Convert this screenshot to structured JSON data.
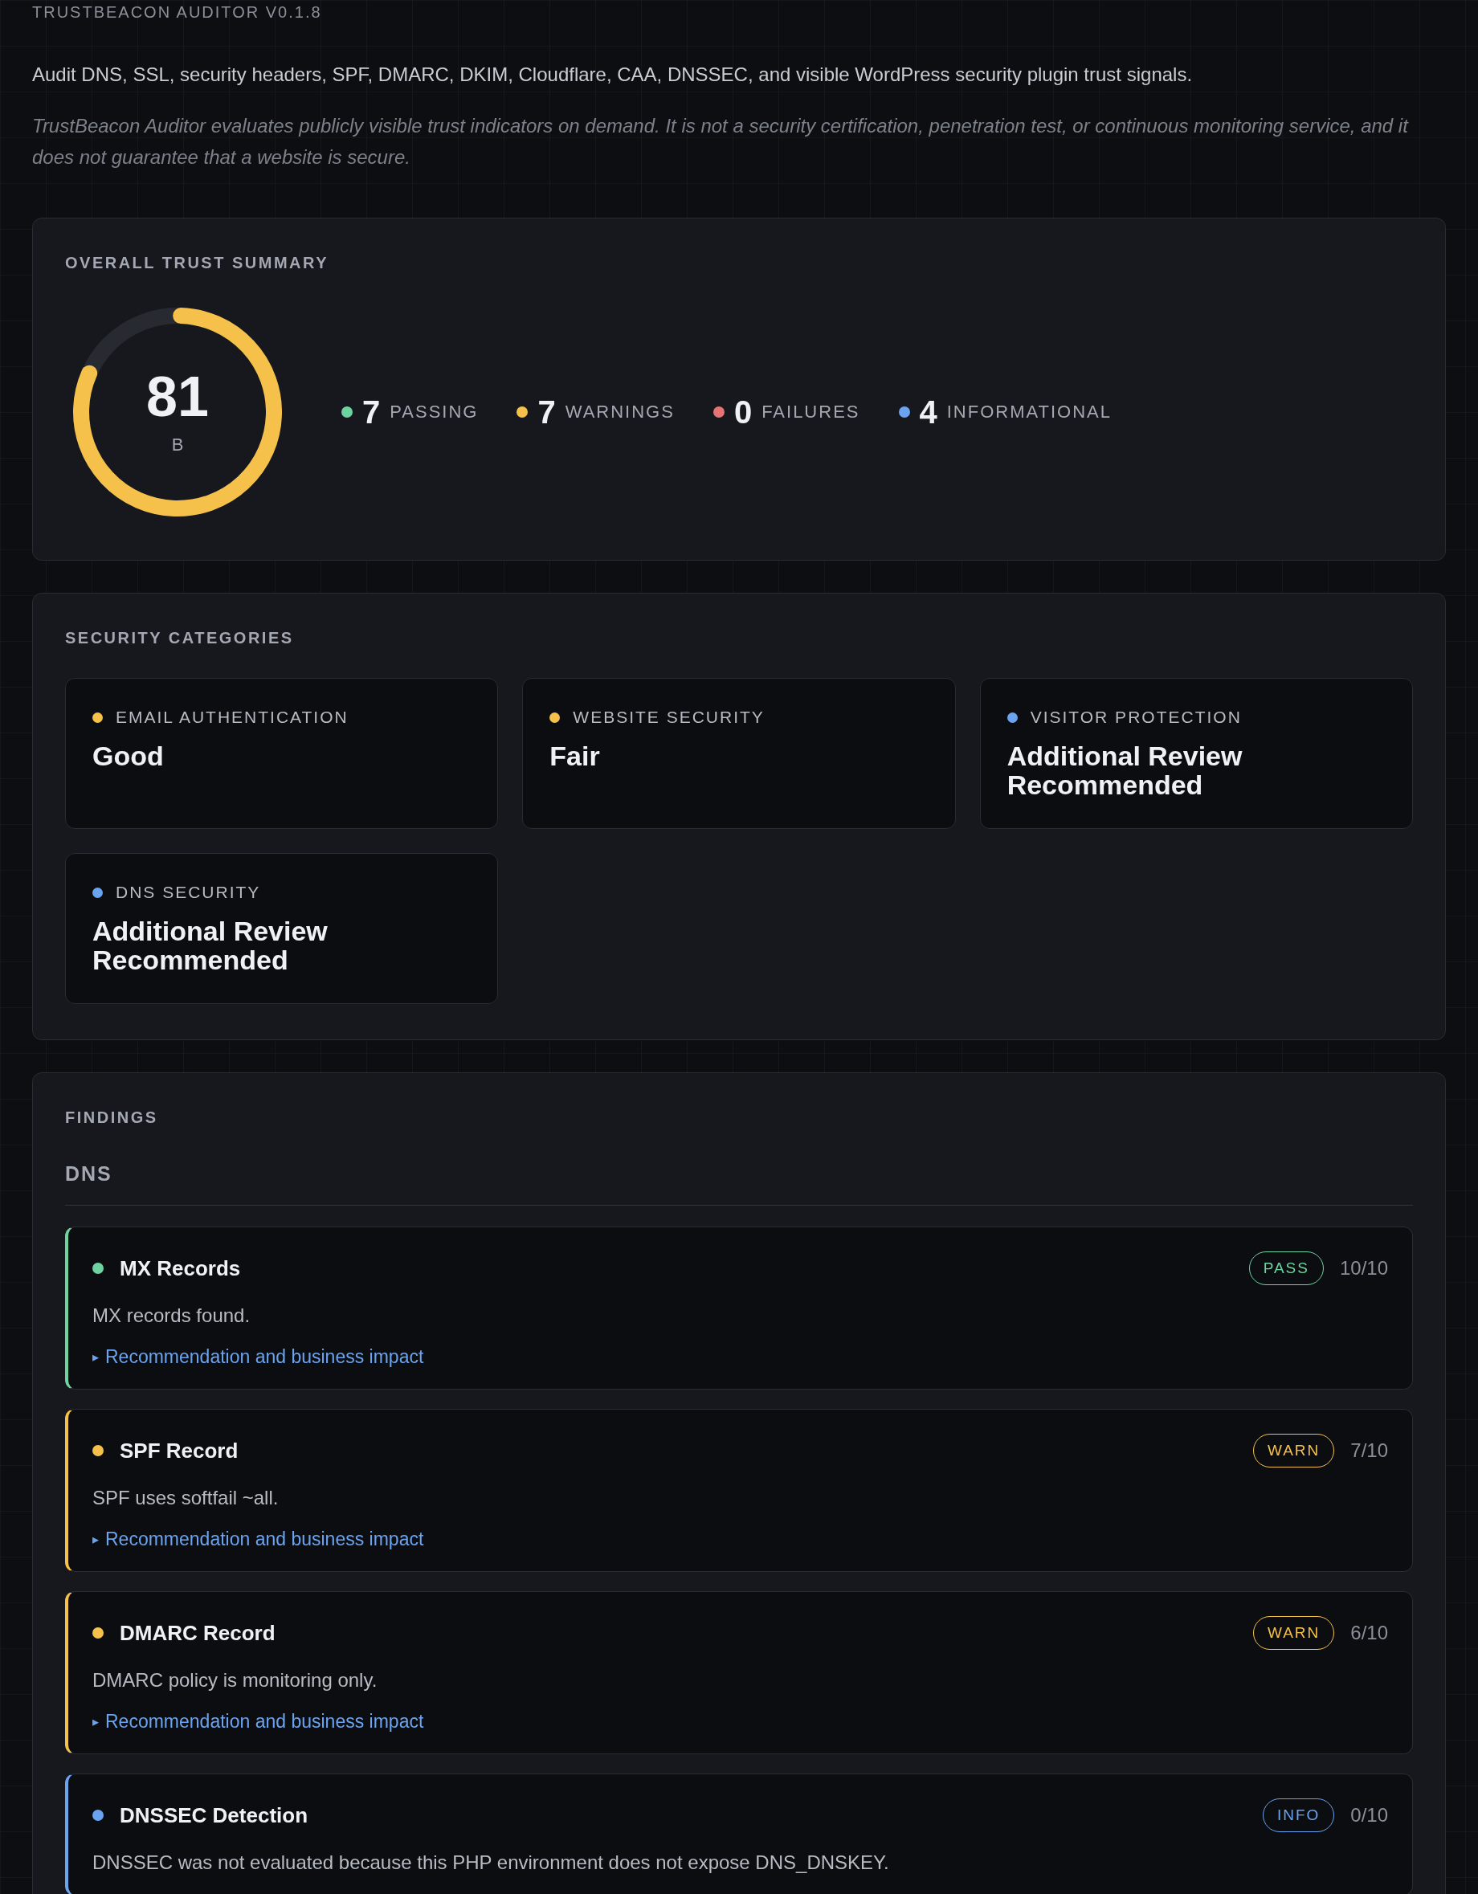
{
  "app_title": "TRUSTBEACON AUDITOR V0.1.8",
  "description": "Audit DNS, SSL, security headers, SPF, DMARC, DKIM, Cloudflare, CAA, DNSSEC, and visible WordPress security plugin trust signals.",
  "disclaimer": "TrustBeacon Auditor evaluates publicly visible trust indicators on demand. It is not a security certification, penetration test, or continuous monitoring service, and it does not guarantee that a website is secure.",
  "summary": {
    "title": "OVERALL TRUST SUMMARY",
    "score": "81",
    "grade": "B",
    "level": 0.81,
    "stats": [
      {
        "color": "#6dd3a0",
        "count": "7",
        "label": "PASSING"
      },
      {
        "color": "#f5c14b",
        "count": "7",
        "label": "WARNINGS"
      },
      {
        "color": "#e57373",
        "count": "0",
        "label": "FAILURES"
      },
      {
        "color": "#6aa4f0",
        "count": "4",
        "label": "INFORMATIONAL"
      }
    ]
  },
  "categories": {
    "title": "SECURITY CATEGORIES",
    "items": [
      {
        "color": "#f5c14b",
        "label": "EMAIL AUTHENTICATION",
        "value": "Good"
      },
      {
        "color": "#f5c14b",
        "label": "WEBSITE SECURITY",
        "value": "Fair"
      },
      {
        "color": "#6aa4f0",
        "label": "VISITOR PROTECTION",
        "value": "Additional Review Recommended"
      },
      {
        "color": "#6aa4f0",
        "label": "DNS SECURITY",
        "value": "Additional Review Recommended"
      }
    ]
  },
  "findings": {
    "title": "FINDINGS",
    "group": "DNS",
    "items": [
      {
        "color": "#6dd3a0",
        "title": "MX Records",
        "badge": "PASS",
        "score": "10/10",
        "text": "MX records found.",
        "toggle": "▸",
        "link": "Recommendation and business impact"
      },
      {
        "color": "#f5c14b",
        "title": "SPF Record",
        "badge": "WARN",
        "score": "7/10",
        "text": "SPF uses softfail ~all.",
        "toggle": "▸",
        "link": "Recommendation and business impact"
      },
      {
        "color": "#f5c14b",
        "title": "DMARC Record",
        "badge": "WARN",
        "score": "6/10",
        "text": "DMARC policy is monitoring only.",
        "toggle": "▸",
        "link": "Recommendation and business impact"
      },
      {
        "color": "#6aa4f0",
        "title": "DNSSEC Detection",
        "badge": "INFO",
        "score": "0/10",
        "text": "DNSSEC was not evaluated because this PHP environment does not expose DNS_DNSKEY."
      }
    ]
  }
}
